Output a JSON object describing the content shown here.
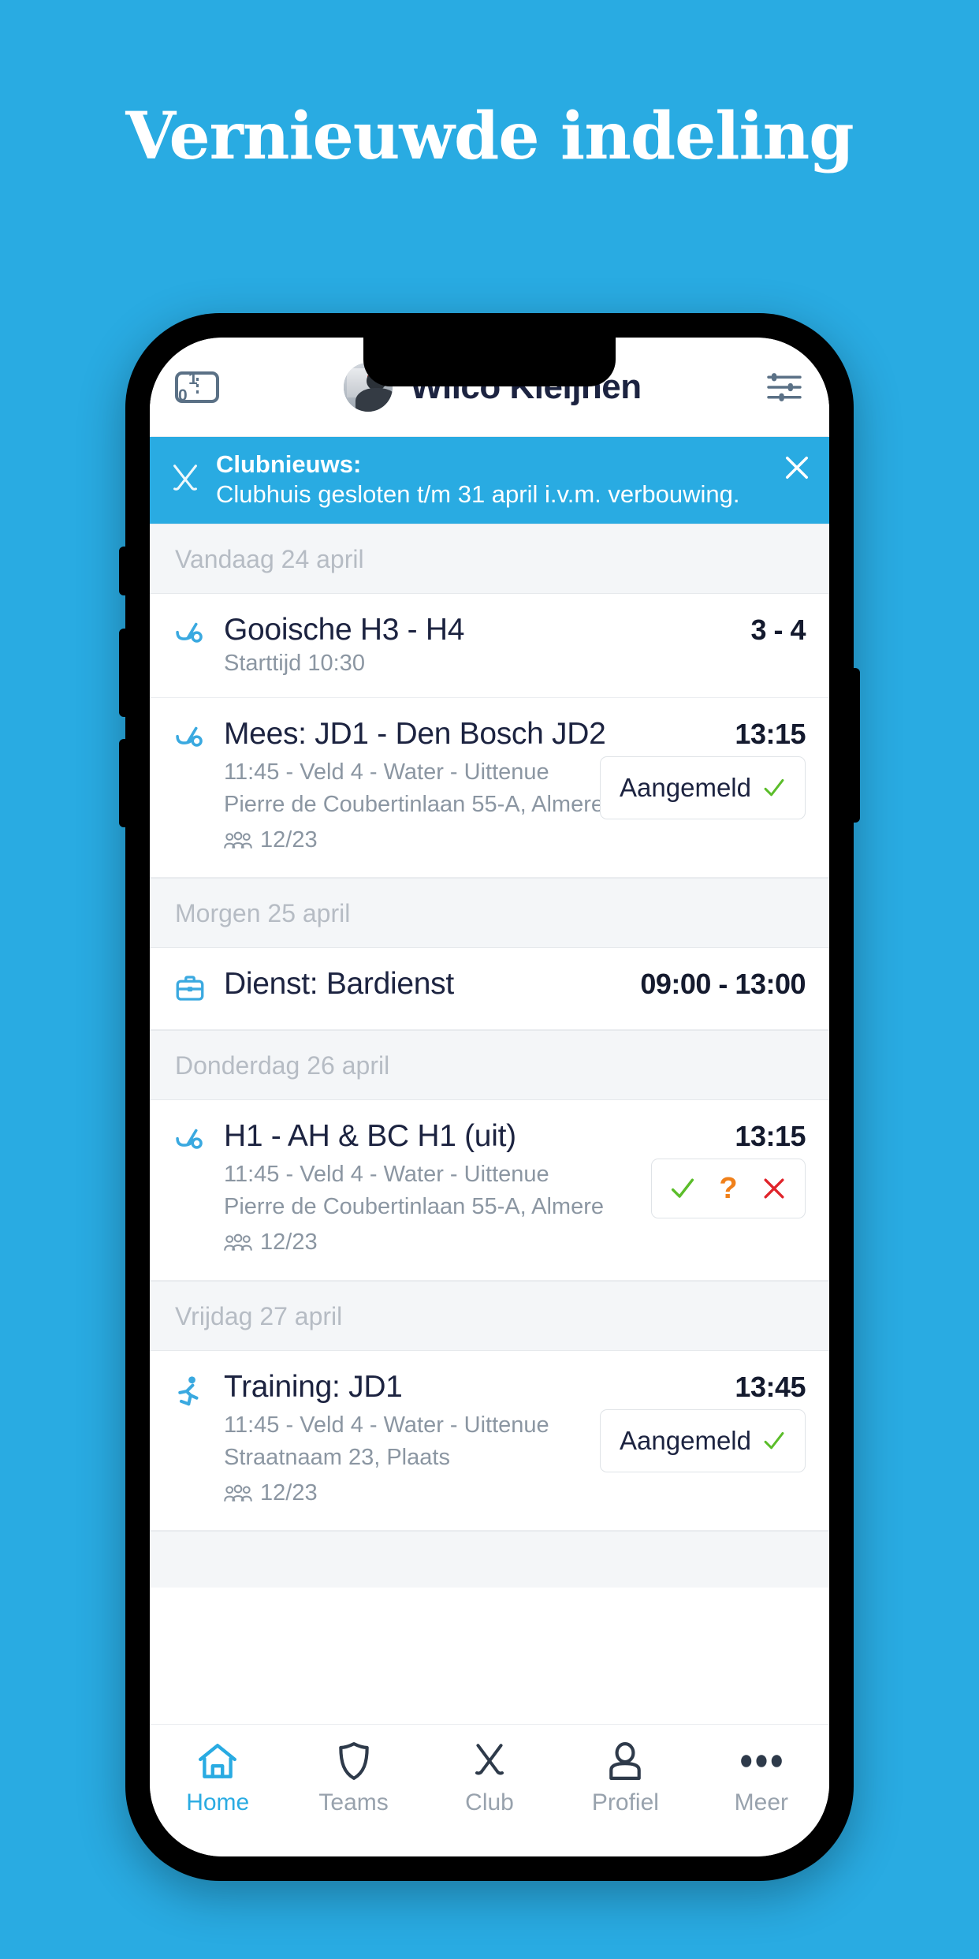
{
  "page": {
    "headline": "Vernieuwde indeling",
    "background_color": "#29ABE2"
  },
  "app": {
    "header": {
      "score_icon_digits": "1 0",
      "user_name": "Wilco Kleijnen",
      "score_icon_name": "scoreboard-icon",
      "settings_icon_name": "sliders-icon"
    },
    "banner": {
      "title": "Clubnieuws:",
      "body": "Clubhuis gesloten t/m 31 april i.v.m. verbouwing.",
      "background_color": "#29ABE2",
      "close_label": "×"
    },
    "sections": [
      {
        "day_label": "Vandaag 24 april",
        "events": [
          {
            "icon": "hockey-stick-icon",
            "title": "Gooische H3 - H4",
            "time": "3 - 4",
            "sub": "Starttijd 10:30",
            "lines": [],
            "attendance": null,
            "action": "none"
          }
        ]
      },
      {
        "day_label": null,
        "events": [
          {
            "icon": "hockey-stick-icon",
            "title": "Mees: JD1 - Den Bosch JD2",
            "time": "13:15",
            "sub": null,
            "lines": [
              "11:45 - Veld 4 - Water - Uittenue",
              "Pierre de Coubertinlaan 55-A, Almere"
            ],
            "attendance": "12/23",
            "action": "aangemeld",
            "action_label": "Aangemeld"
          }
        ]
      },
      {
        "day_label": "Morgen 25 april",
        "events": [
          {
            "icon": "briefcase-icon",
            "title": "Dienst: Bardienst",
            "time": "09:00 - 13:00",
            "sub": null,
            "lines": [],
            "attendance": null,
            "action": "none"
          }
        ]
      },
      {
        "day_label": "Donderdag 26 april",
        "events": [
          {
            "icon": "hockey-stick-icon",
            "title": "H1 - AH & BC H1 (uit)",
            "time": "13:15",
            "sub": null,
            "lines": [
              "11:45 - Veld 4 - Water - Uittenue",
              "Pierre de Coubertinlaan 55-A, Almere"
            ],
            "attendance": "12/23",
            "action": "rsvp",
            "rsvp": {
              "yes": "✓",
              "maybe": "?",
              "no": "✕",
              "yes_color": "#5bbd2a",
              "maybe_color": "#f0801a",
              "no_color": "#e0242b"
            }
          }
        ]
      },
      {
        "day_label": "Vrijdag 27 april",
        "events": [
          {
            "icon": "running-icon",
            "title": "Training: JD1",
            "time": "13:45",
            "sub": null,
            "lines": [
              "11:45 - Veld 4 - Water - Uittenue",
              "Straatnaam 23, Plaats"
            ],
            "attendance": "12/23",
            "action": "aangemeld",
            "action_label": "Aangemeld"
          }
        ]
      }
    ],
    "tabbar": {
      "items": [
        {
          "label": "Home",
          "icon": "home-icon",
          "active": true
        },
        {
          "label": "Teams",
          "icon": "shield-icon",
          "active": false
        },
        {
          "label": "Club",
          "icon": "crossed-hockey-sticks-icon",
          "active": false
        },
        {
          "label": "Profiel",
          "icon": "person-icon",
          "active": false
        },
        {
          "label": "Meer",
          "icon": "ellipsis-icon",
          "active": false
        }
      ],
      "active_color": "#29ABE2",
      "inactive_color": "#98a2ad"
    }
  }
}
